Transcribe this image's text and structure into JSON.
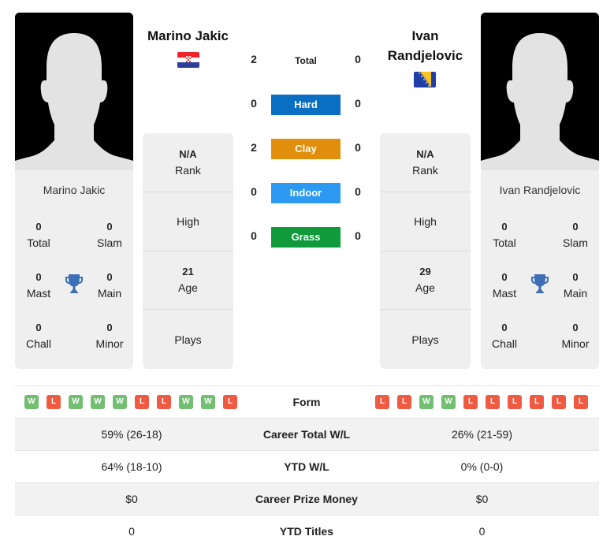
{
  "colors": {
    "hard": "#0a6fc2",
    "clay": "#e08e0b",
    "indoor": "#2c9af2",
    "grass": "#0f9a3c",
    "win": "#72bf72",
    "loss": "#ef5a42",
    "trophy": "#3d6fb6"
  },
  "player1": {
    "name": "Marino Jakic",
    "flag": "croatia-flag",
    "titles": {
      "total": {
        "value": "0",
        "label": "Total"
      },
      "slam": {
        "value": "0",
        "label": "Slam"
      },
      "mast": {
        "value": "0",
        "label": "Mast"
      },
      "main": {
        "value": "0",
        "label": "Main"
      },
      "chall": {
        "value": "0",
        "label": "Chall"
      },
      "minor": {
        "value": "0",
        "label": "Minor"
      }
    },
    "info": {
      "rank": {
        "value": "N/A",
        "label": "Rank"
      },
      "high": {
        "label": "High"
      },
      "age": {
        "value": "21",
        "label": "Age"
      },
      "plays": {
        "label": "Plays"
      }
    },
    "form": [
      "W",
      "L",
      "W",
      "W",
      "W",
      "L",
      "L",
      "W",
      "W",
      "L"
    ]
  },
  "player2": {
    "name": "Ivan Randjelovic",
    "name_line1": "Ivan",
    "name_line2": "Randjelovic",
    "flag": "bosnia-flag",
    "titles": {
      "total": {
        "value": "0",
        "label": "Total"
      },
      "slam": {
        "value": "0",
        "label": "Slam"
      },
      "mast": {
        "value": "0",
        "label": "Mast"
      },
      "main": {
        "value": "0",
        "label": "Main"
      },
      "chall": {
        "value": "0",
        "label": "Chall"
      },
      "minor": {
        "value": "0",
        "label": "Minor"
      }
    },
    "info": {
      "rank": {
        "value": "N/A",
        "label": "Rank"
      },
      "high": {
        "label": "High"
      },
      "age": {
        "value": "29",
        "label": "Age"
      },
      "plays": {
        "label": "Plays"
      }
    },
    "form": [
      "L",
      "L",
      "W",
      "W",
      "L",
      "L",
      "L",
      "L",
      "L",
      "L"
    ]
  },
  "h2h": [
    {
      "label": "Total",
      "p1": "2",
      "p2": "0",
      "color": null
    },
    {
      "label": "Hard",
      "p1": "0",
      "p2": "0",
      "color": "#0a6fc2"
    },
    {
      "label": "Clay",
      "p1": "2",
      "p2": "0",
      "color": "#e08e0b"
    },
    {
      "label": "Indoor",
      "p1": "0",
      "p2": "0",
      "color": "#2c9af2"
    },
    {
      "label": "Grass",
      "p1": "0",
      "p2": "0",
      "color": "#0f9a3c"
    }
  ],
  "comparison": {
    "form_label": "Form",
    "rows": [
      {
        "label": "Career Total W/L",
        "p1": "59% (26-18)",
        "p2": "26% (21-59)"
      },
      {
        "label": "YTD W/L",
        "p1": "64% (18-10)",
        "p2": "0% (0-0)"
      },
      {
        "label": "Career Prize Money",
        "p1": "$0",
        "p2": "$0"
      },
      {
        "label": "YTD Titles",
        "p1": "0",
        "p2": "0"
      }
    ]
  }
}
